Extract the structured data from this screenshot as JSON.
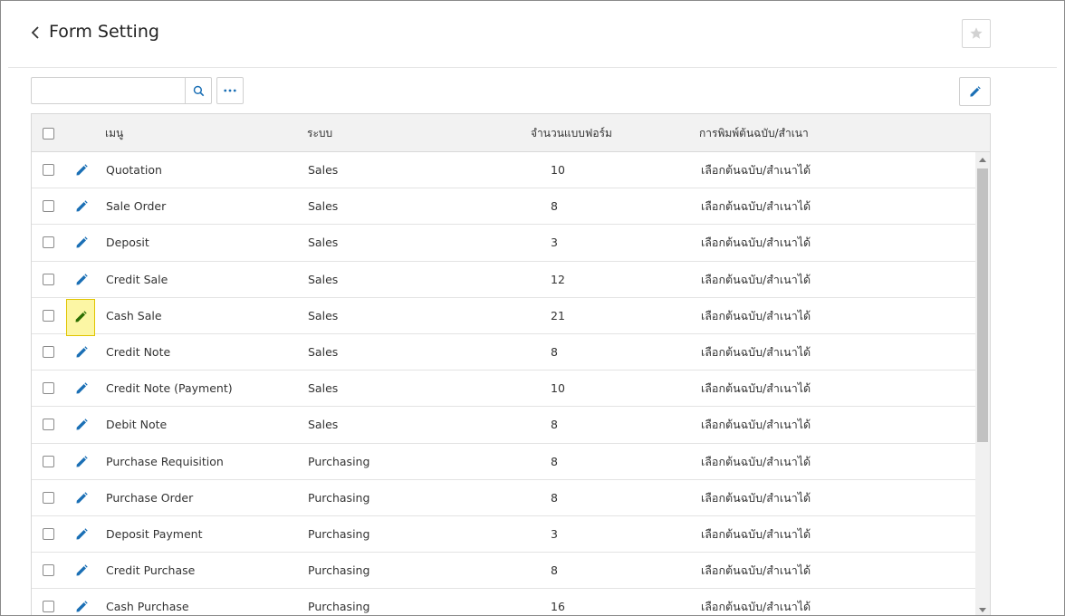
{
  "header": {
    "title": "Form Setting"
  },
  "toolbar": {
    "search_value": "",
    "search_placeholder": ""
  },
  "table": {
    "columns": [
      "เมนู",
      "ระบบ",
      "จำนวนแบบฟอร์ม",
      "การพิมพ์ต้นฉบับ/สำเนา"
    ],
    "rows": [
      {
        "menu": "Quotation",
        "system": "Sales",
        "count": "10",
        "print": "เลือกต้นฉบับ/สำเนาได้"
      },
      {
        "menu": "Sale Order",
        "system": "Sales",
        "count": "8",
        "print": "เลือกต้นฉบับ/สำเนาได้"
      },
      {
        "menu": "Deposit",
        "system": "Sales",
        "count": "3",
        "print": "เลือกต้นฉบับ/สำเนาได้"
      },
      {
        "menu": "Credit Sale",
        "system": "Sales",
        "count": "12",
        "print": "เลือกต้นฉบับ/สำเนาได้"
      },
      {
        "menu": "Cash Sale",
        "system": "Sales",
        "count": "21",
        "print": "เลือกต้นฉบับ/สำเนาได้",
        "highlighted": true
      },
      {
        "menu": "Credit Note",
        "system": "Sales",
        "count": "8",
        "print": "เลือกต้นฉบับ/สำเนาได้"
      },
      {
        "menu": "Credit Note (Payment)",
        "system": "Sales",
        "count": "10",
        "print": "เลือกต้นฉบับ/สำเนาได้"
      },
      {
        "menu": "Debit Note",
        "system": "Sales",
        "count": "8",
        "print": "เลือกต้นฉบับ/สำเนาได้"
      },
      {
        "menu": "Purchase Requisition",
        "system": "Purchasing",
        "count": "8",
        "print": "เลือกต้นฉบับ/สำเนาได้"
      },
      {
        "menu": "Purchase Order",
        "system": "Purchasing",
        "count": "8",
        "print": "เลือกต้นฉบับ/สำเนาได้"
      },
      {
        "menu": "Deposit Payment",
        "system": "Purchasing",
        "count": "3",
        "print": "เลือกต้นฉบับ/สำเนาได้"
      },
      {
        "menu": "Credit Purchase",
        "system": "Purchasing",
        "count": "8",
        "print": "เลือกต้นฉบับ/สำเนาได้"
      },
      {
        "menu": "Cash Purchase",
        "system": "Purchasing",
        "count": "16",
        "print": "เลือกต้นฉบับ/สำเนาได้"
      }
    ]
  },
  "colors": {
    "accent": "#1a6fb5",
    "highlight": "#fcf6a4",
    "highlight_icon": "#2b6e00"
  }
}
